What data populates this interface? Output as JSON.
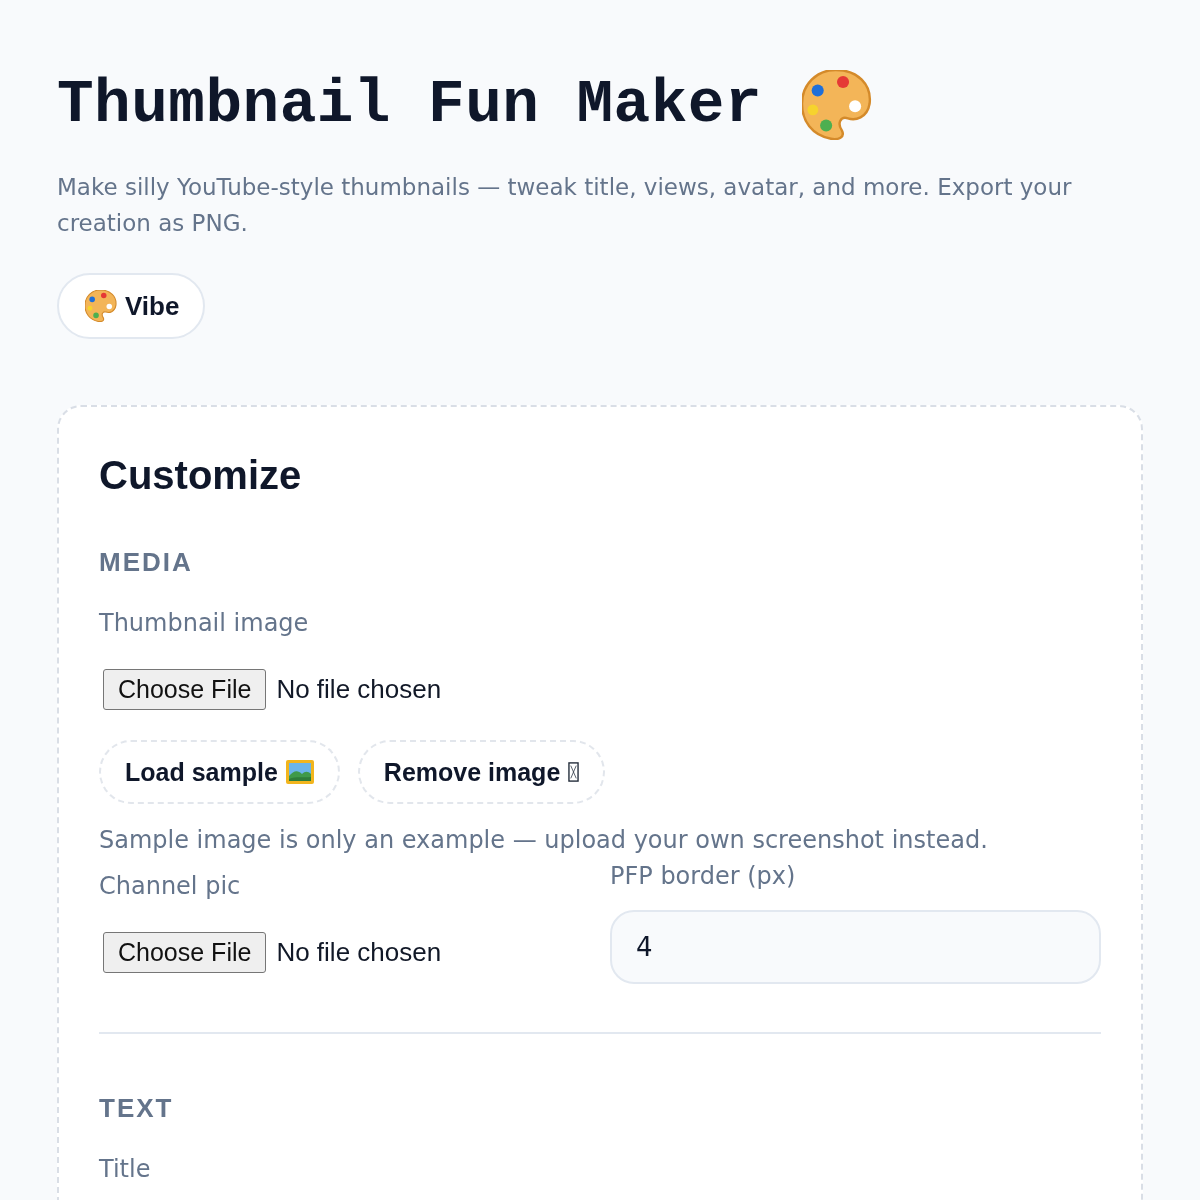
{
  "header": {
    "title": "Thumbnail Fun Maker",
    "subtitle": "Make silly YouTube-style thumbnails — tweak title, views, avatar, and more. Export your creation as PNG.",
    "vibe_button": {
      "label": "Vibe"
    }
  },
  "panel": {
    "title": "Customize",
    "sections": [
      {
        "heading": "MEDIA",
        "items": [
          {
            "kind": "file",
            "label": "Thumbnail image",
            "button": "Choose File",
            "status": "No file chosen"
          },
          {
            "kind": "actions",
            "buttons": [
              {
                "kind": "sample",
                "label": "Load sample"
              },
              {
                "kind": "remove",
                "label": "Remove image"
              }
            ]
          },
          {
            "kind": "hint",
            "text": "Sample image is only an example — upload your own screenshot instead."
          },
          {
            "kind": "pair",
            "columns": [
              {
                "kind": "file",
                "label": "Channel pic",
                "button": "Choose File",
                "status": "No file chosen"
              },
              {
                "kind": "number",
                "label": "PFP border (px)",
                "value": "4"
              }
            ]
          }
        ]
      },
      {
        "heading": "TEXT",
        "items": [
          {
            "kind": "label",
            "label": "Title"
          }
        ]
      }
    ]
  }
}
